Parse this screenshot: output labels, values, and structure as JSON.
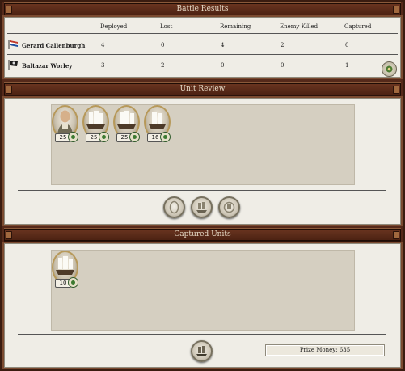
{
  "battle_results": {
    "title": "Battle Results",
    "columns": [
      "Deployed",
      "Lost",
      "Remaining",
      "Enemy Killed",
      "Captured"
    ],
    "rows": [
      {
        "name": "Gerard Callenburgh",
        "flag_icon": "dutch-flag-icon",
        "deployed": "4",
        "lost": "0",
        "remaining": "4",
        "enemy_killed": "2",
        "captured": "0"
      },
      {
        "name": "Baltazar Worley",
        "flag_icon": "pirate-flag-icon",
        "deployed": "3",
        "lost": "2",
        "remaining": "0",
        "enemy_killed": "0",
        "captured": "1"
      }
    ]
  },
  "unit_review": {
    "title": "Unit Review",
    "units": [
      {
        "type": "general-portrait",
        "count": "25"
      },
      {
        "type": "ship",
        "count": "25"
      },
      {
        "type": "ship",
        "count": "25"
      },
      {
        "type": "ship",
        "count": "16"
      }
    ],
    "buttons": [
      "portrait-filter-icon",
      "ship-filter-icon",
      "fleet-filter-icon"
    ]
  },
  "captured_units": {
    "title": "Captured Units",
    "units": [
      {
        "type": "ship",
        "count": "10"
      }
    ],
    "prize_money_label": "Prize Money:",
    "prize_money_value": "635"
  },
  "colors": {
    "frame": "#55291a",
    "header": "#6b3520",
    "panel": "#efede6",
    "sandbox": "#d5cfc1",
    "badge_green": "#3c7a30"
  }
}
